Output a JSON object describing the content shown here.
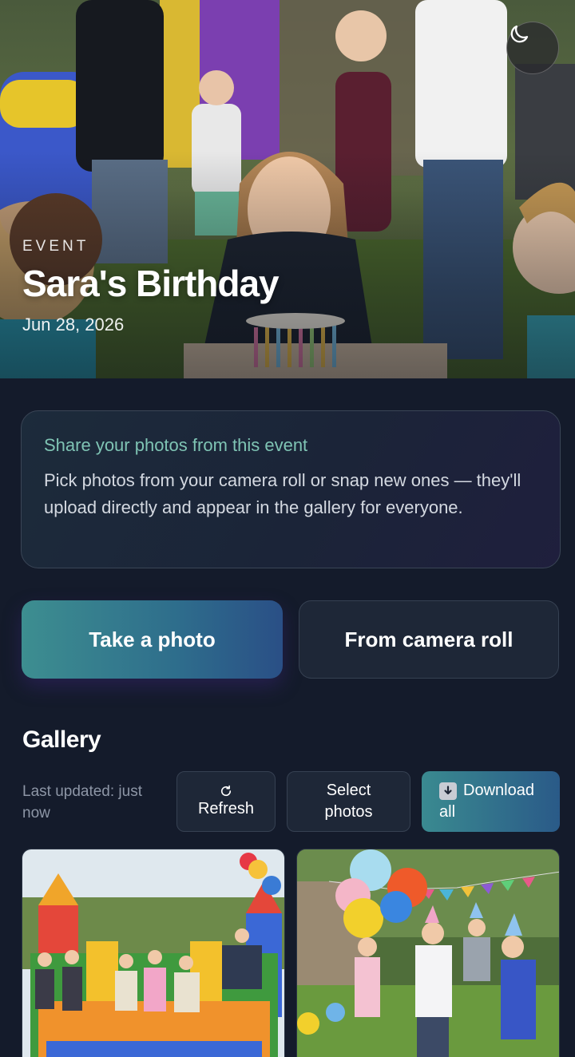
{
  "hero": {
    "eyebrow": "EVENT",
    "title": "Sara's Birthday",
    "date": "Jun 28, 2026",
    "theme_toggle_icon": "moon-icon",
    "image_subject": "girl-blowing-out-birthday-candles"
  },
  "info_card": {
    "title": "Share your photos from this event",
    "body": "Pick photos from your camera roll or snap new ones — they'll upload directly and appear in the gallery for everyone."
  },
  "actions": {
    "take_photo": "Take a photo",
    "camera_roll": "From camera roll"
  },
  "gallery": {
    "title": "Gallery",
    "last_updated": "Last updated: just now",
    "refresh_icon": "refresh-icon",
    "refresh_label": "Refresh",
    "select_label_line1": "Select",
    "select_label_line2": "photos",
    "download_icon": "download-icon",
    "download_label_line1": "Download",
    "download_label_line2": "all",
    "photos": [
      {
        "subject": "kids-jumping-in-bounce-house"
      },
      {
        "subject": "kids-with-balloons-and-party-hats"
      }
    ]
  },
  "colors": {
    "background": "#141b2b",
    "accent_teal": "#3d8e90",
    "accent_blue": "#2a4f86",
    "info_title": "#7fc4b4",
    "muted_text": "#8d96a6"
  }
}
